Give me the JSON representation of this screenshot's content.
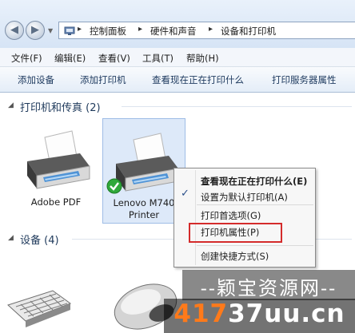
{
  "breadcrumb": {
    "items": [
      "控制面板",
      "硬件和声音",
      "设备和打印机"
    ],
    "separator": "▸"
  },
  "menubar": {
    "items": [
      "文件(F)",
      "编辑(E)",
      "查看(V)",
      "工具(T)",
      "帮助(H)"
    ]
  },
  "toolbar": {
    "buttons": [
      "添加设备",
      "添加打印机",
      "查看现在正在打印什么",
      "打印服务器属性"
    ]
  },
  "groups": {
    "printers": {
      "title": "打印机和传真 (2)"
    },
    "devices": {
      "title": "设备 (4)"
    }
  },
  "printers": [
    {
      "name": "Adobe PDF",
      "icon": "printer-icon",
      "default": false
    },
    {
      "name_line1": "Lenovo M740",
      "name_line2": "Printer",
      "icon": "printer-icon",
      "default": true,
      "selected": true
    }
  ],
  "context_menu": {
    "items": [
      {
        "label": "查看现在正在打印什么(E)",
        "bold": true
      },
      {
        "label": "设置为默认打印机(A)",
        "checked": true
      },
      {
        "label": "打印首选项(G)"
      },
      {
        "label": "打印机属性(P)",
        "highlighted": true
      },
      {
        "label": "创建快捷方式(S)"
      }
    ],
    "highlight_color": "#d42b2b"
  },
  "watermark": {
    "top": "--颖宝资源网--",
    "bottom_part1": "417",
    "bottom_part2": "37uu.cn"
  },
  "colors": {
    "accent": "#1e395b",
    "selection": "#dde9f9",
    "check_badge": "#2fa83a"
  }
}
